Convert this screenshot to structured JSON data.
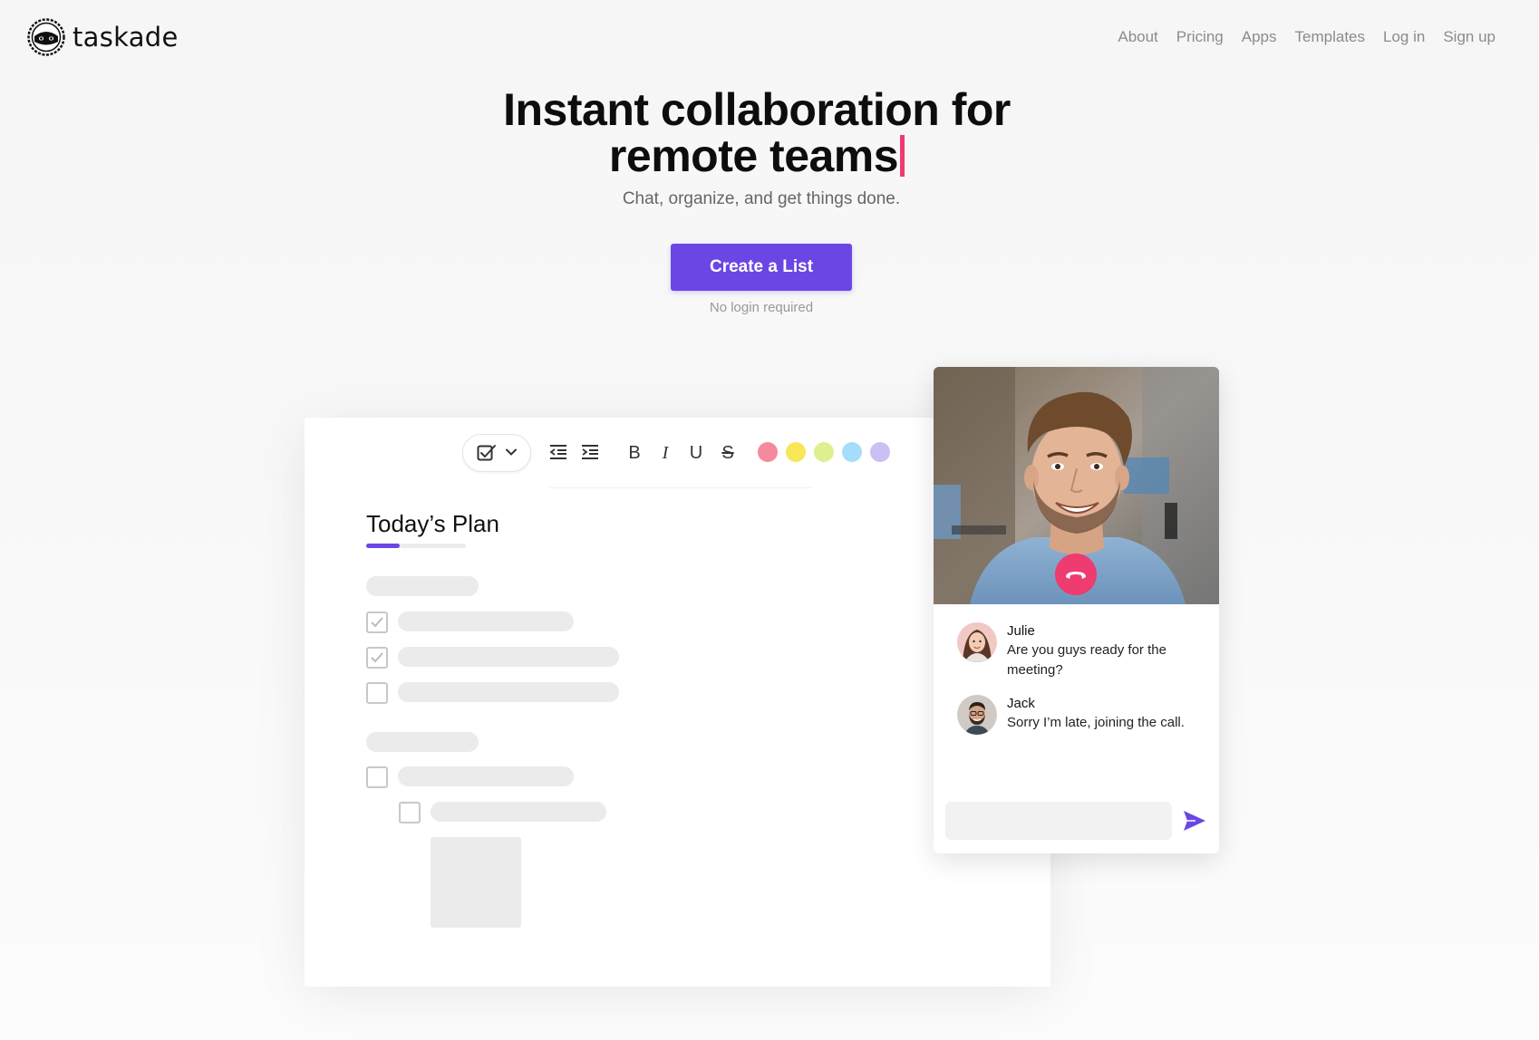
{
  "brand": {
    "name": "taskade"
  },
  "nav": {
    "items": [
      {
        "label": "About"
      },
      {
        "label": "Pricing"
      },
      {
        "label": "Apps"
      },
      {
        "label": "Templates"
      },
      {
        "label": "Log in"
      },
      {
        "label": "Sign up"
      }
    ]
  },
  "hero": {
    "title_line1": "Instant collaboration for",
    "title_line2": "remote teams",
    "subtitle": "Chat, organize, and get things done.",
    "cta_label": "Create a List",
    "cta_note": "No login required"
  },
  "editor": {
    "title": "Today’s Plan",
    "progress": 0.34,
    "toolbar": {
      "bold": "B",
      "italic": "I",
      "underline": "U",
      "strikethrough": "S",
      "colors": [
        "#f5899e",
        "#f8e756",
        "#ddf08f",
        "#a6ddfb",
        "#cbbff5"
      ]
    },
    "tasks": [
      {
        "checked": true
      },
      {
        "checked": true
      },
      {
        "checked": false
      },
      {
        "checked": false
      },
      {
        "checked": false
      }
    ]
  },
  "chat": {
    "messages": [
      {
        "name": "Julie",
        "text": "Are you guys ready for the meeting?"
      },
      {
        "name": "Jack",
        "text": "Sorry I’m late, joining the call."
      }
    ],
    "input_placeholder": ""
  },
  "colors": {
    "accent": "#6b46e5",
    "danger": "#ee3b70"
  }
}
